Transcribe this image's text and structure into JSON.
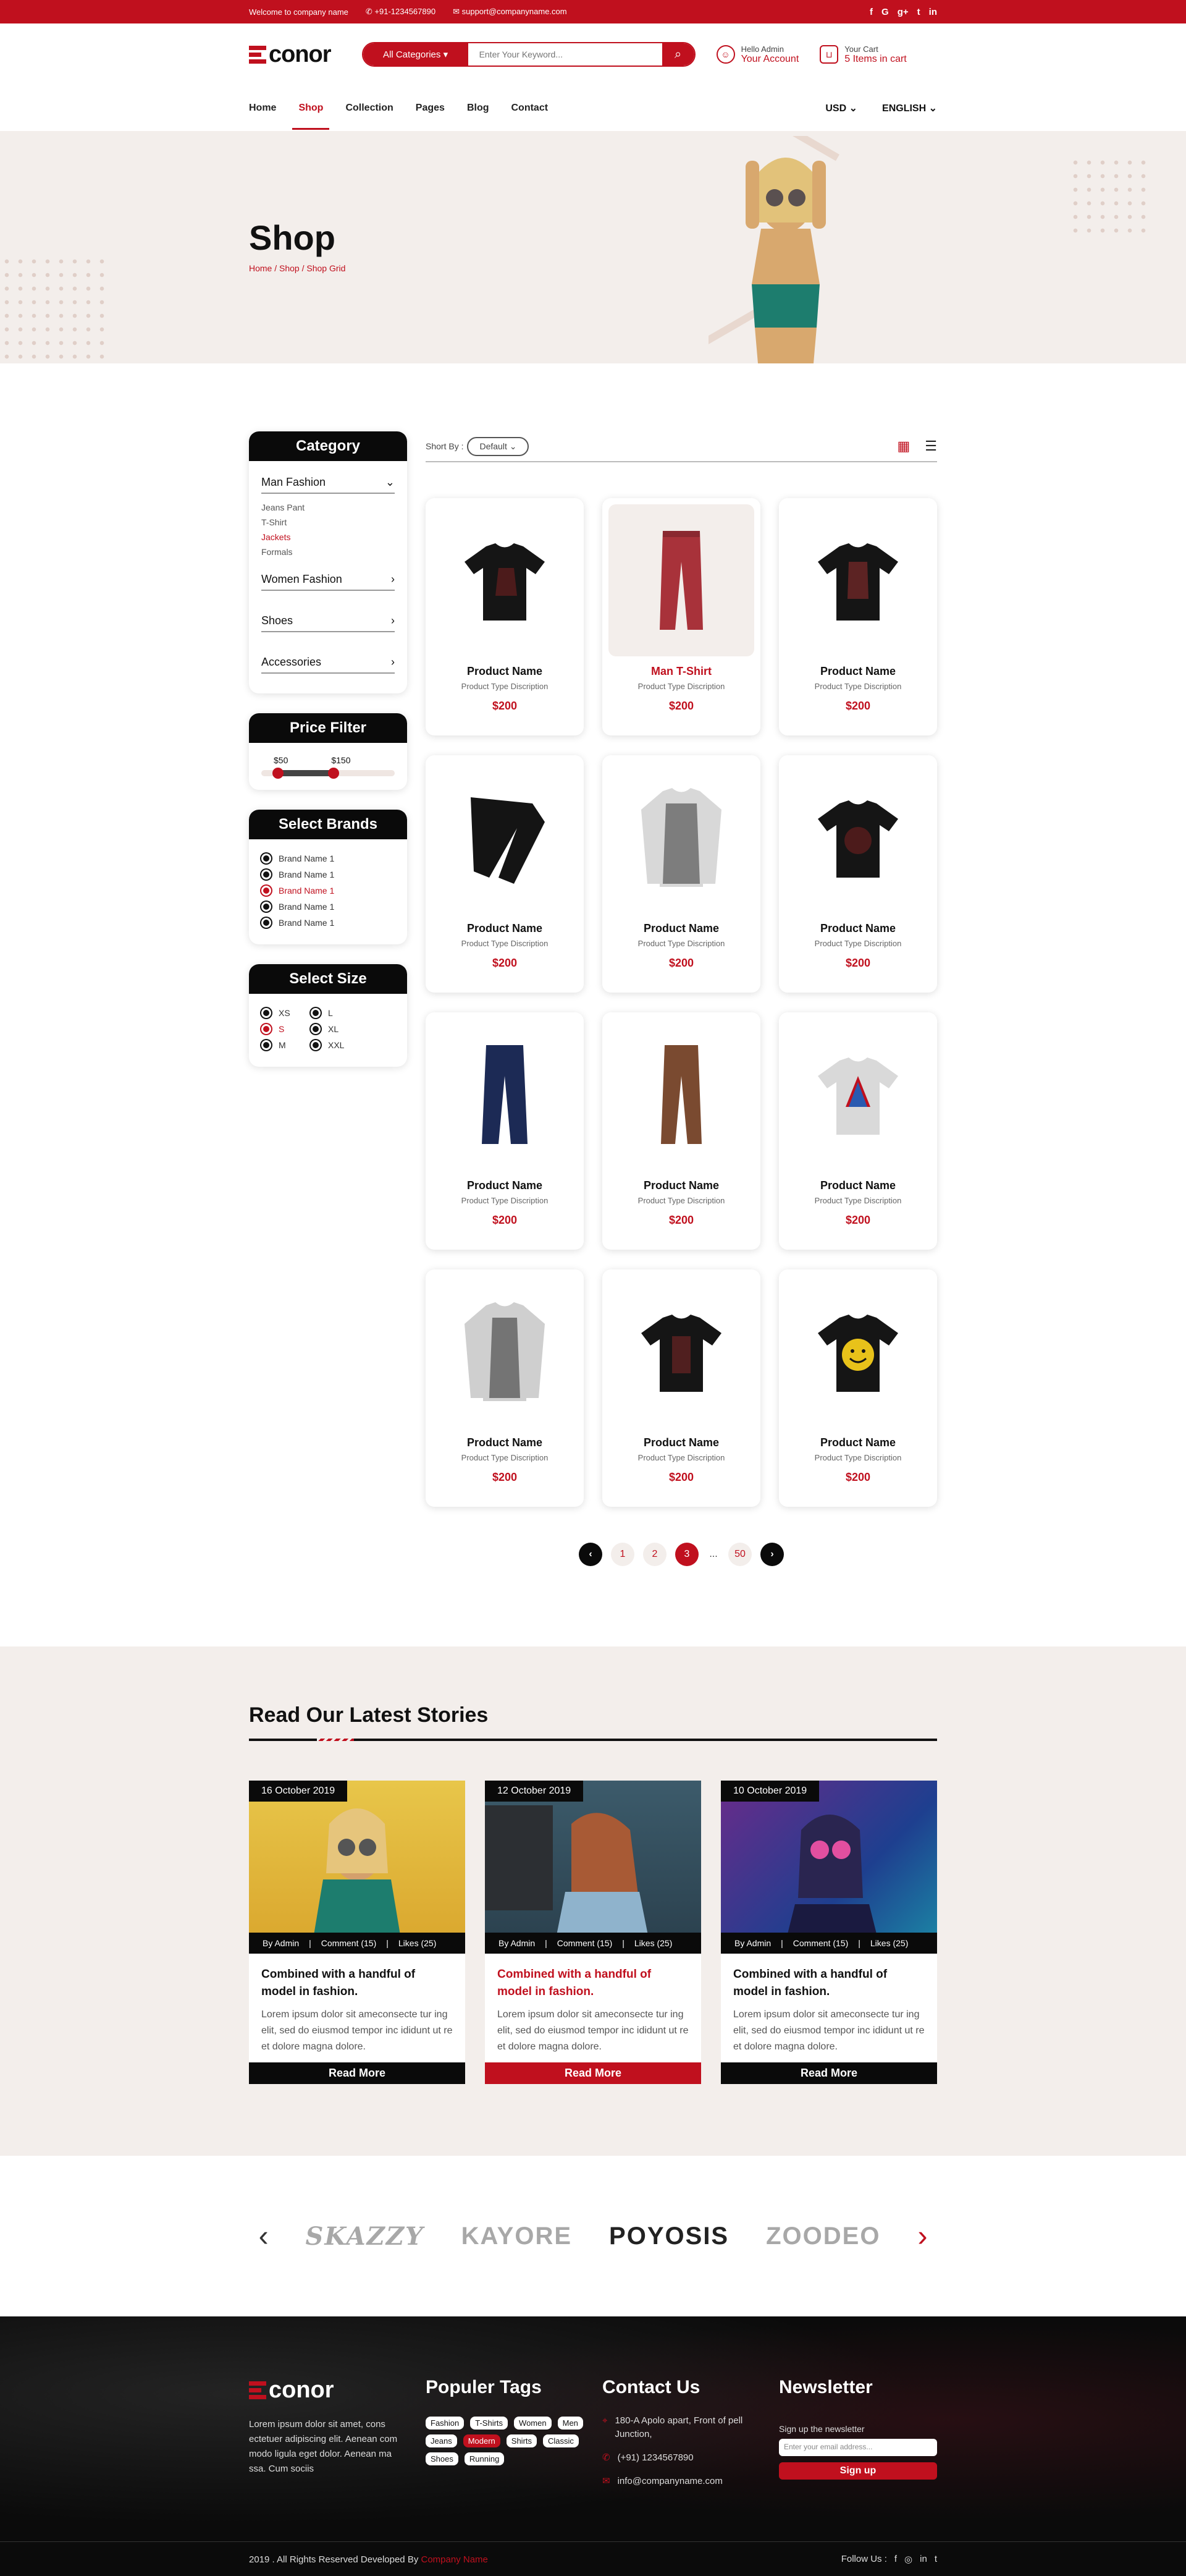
{
  "topbar": {
    "welcome": "Welcome to company name",
    "phone": "+91-1234567890",
    "email": "support@companyname.com",
    "social": [
      "f",
      "G",
      "g+",
      "t",
      "in"
    ]
  },
  "header": {
    "logo": "conor",
    "categories_label": "All Categories",
    "search_placeholder": "Enter Your Keyword...",
    "account_small": "Hello Admin",
    "account_label": "Your Account",
    "cart_small": "Your Cart",
    "cart_label": "5 Items in cart"
  },
  "nav": {
    "items": [
      "Home",
      "Shop",
      "Collection",
      "Pages",
      "Blog",
      "Contact"
    ],
    "currency": "USD",
    "language": "ENGLISH"
  },
  "banner": {
    "title": "Shop",
    "breadcrumb": "Home / Shop / Shop Grid"
  },
  "sidebar": {
    "category_title": "Category",
    "groups": [
      "Man Fashion",
      "Women Fashion",
      "Shoes",
      "Accessories"
    ],
    "man_sub": [
      "Jeans Pant",
      "T-Shirt",
      "Jackets",
      "Formals"
    ],
    "price_title": "Price Filter",
    "price_min": "$50",
    "price_max": "$150",
    "brands_title": "Select Brands",
    "brands": [
      "Brand Name 1",
      "Brand Name 1",
      "Brand Name 1",
      "Brand Name 1",
      "Brand Name 1"
    ],
    "size_title": "Select Size",
    "sizes": [
      "XS",
      "L",
      "S",
      "XL",
      "M",
      "XXL"
    ]
  },
  "sort": {
    "label": "Short By :",
    "value": "Default"
  },
  "products": [
    {
      "name": "Product Name",
      "desc": "Product Type Discription",
      "price": "$200"
    },
    {
      "name": "Man T-Shirt",
      "desc": "Product Type Discription",
      "price": "$200"
    },
    {
      "name": "Product Name",
      "desc": "Product Type Discription",
      "price": "$200"
    },
    {
      "name": "Product Name",
      "desc": "Product Type Discription",
      "price": "$200"
    },
    {
      "name": "Product Name",
      "desc": "Product Type Discription",
      "price": "$200"
    },
    {
      "name": "Product Name",
      "desc": "Product Type Discription",
      "price": "$200"
    },
    {
      "name": "Product Name",
      "desc": "Product Type Discription",
      "price": "$200"
    },
    {
      "name": "Product Name",
      "desc": "Product Type Discription",
      "price": "$200"
    },
    {
      "name": "Product Name",
      "desc": "Product Type Discription",
      "price": "$200"
    },
    {
      "name": "Product Name",
      "desc": "Product Type Discription",
      "price": "$200"
    },
    {
      "name": "Product Name",
      "desc": "Product Type Discription",
      "price": "$200"
    },
    {
      "name": "Product Name",
      "desc": "Product Type Discription",
      "price": "$200"
    }
  ],
  "pagination": [
    "1",
    "2",
    "3",
    "...",
    "50"
  ],
  "stories": {
    "title": "Read Our Latest Stories",
    "posts": [
      {
        "date": "16 October 2019",
        "by": "By Admin",
        "comments": "Comment (15)",
        "likes": "Likes (25)",
        "title": "Combined with a handful of model in fashion.",
        "text": "Lorem ipsum dolor sit ameconsecte tur ing elit, sed do eiusmod tempor inc ididunt ut re et dolore magna dolore.",
        "more": "Read More"
      },
      {
        "date": "12 October 2019",
        "by": "By Admin",
        "comments": "Comment (15)",
        "likes": "Likes (25)",
        "title": "Combined with a handful of model in fashion.",
        "text": "Lorem ipsum dolor sit ameconsecte tur ing elit, sed do eiusmod tempor inc ididunt ut re et dolore magna dolore.",
        "more": "Read More"
      },
      {
        "date": "10 October 2019",
        "by": "By Admin",
        "comments": "Comment (15)",
        "likes": "Likes (25)",
        "title": "Combined with a handful of model in fashion.",
        "text": "Lorem ipsum dolor sit ameconsecte tur ing elit, sed do eiusmod tempor inc ididunt ut re et dolore magna dolore.",
        "more": "Read More"
      }
    ]
  },
  "brands": [
    "SKAZZY",
    "KAYORE",
    "POYOSIS",
    "ZOODEO"
  ],
  "footer": {
    "logo": "conor",
    "about": "Lorem ipsum dolor sit amet, cons ectetuer adipiscing elit. Aenean com modo ligula eget dolor. Aenean ma ssa. Cum sociis",
    "tags_title": "Populer Tags",
    "tags": [
      "Fashion",
      "T-Shirts",
      "Women",
      "Men",
      "Jeans",
      "Modern",
      "Shirts",
      "Classic",
      "Shoes",
      "Running"
    ],
    "contact_title": "Contact Us",
    "address": "180-A Apolo apart, Front of pell Junction,",
    "phone": "(+91) 1234567890",
    "email": "info@companyname.com",
    "newsletter_title": "Newsletter",
    "newsletter_text": "Sign up the newsletter",
    "newsletter_placeholder": "Enter your email address...",
    "signup": "Sign up",
    "copyright": "2019 . All Rights Reserved Developed By",
    "company": "Company Name",
    "follow": "Follow Us :"
  },
  "colors": {
    "accent": "#c0101e",
    "dark": "#0a0a0a",
    "cream": "#f3eeeb"
  }
}
